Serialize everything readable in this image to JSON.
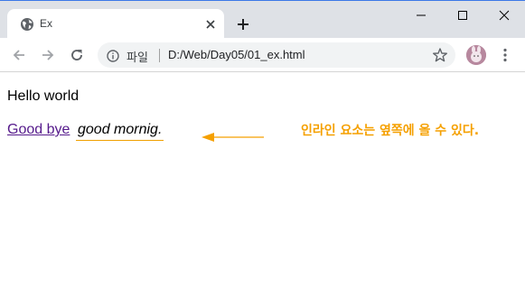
{
  "tab": {
    "title": "Ex"
  },
  "omnibox": {
    "security_label": "파일",
    "url": "D:/Web/Day05/01_ex.html"
  },
  "page": {
    "hello": "Hello world",
    "link": "Good bye",
    "em": "good mornig.",
    "note": "인라인 요소는 옆쪽에 올 수 있다."
  },
  "colors": {
    "annotation": "#f5a000",
    "visited_link": "#551a8b",
    "titlebar": "#dee1e6"
  },
  "icons": [
    "globe-icon",
    "close-icon",
    "plus-icon",
    "minimize-icon",
    "maximize-icon",
    "window-close-icon",
    "back-arrow-icon",
    "forward-arrow-icon",
    "reload-icon",
    "info-icon",
    "star-icon",
    "more-vert-icon",
    "arrow-left-icon"
  ]
}
